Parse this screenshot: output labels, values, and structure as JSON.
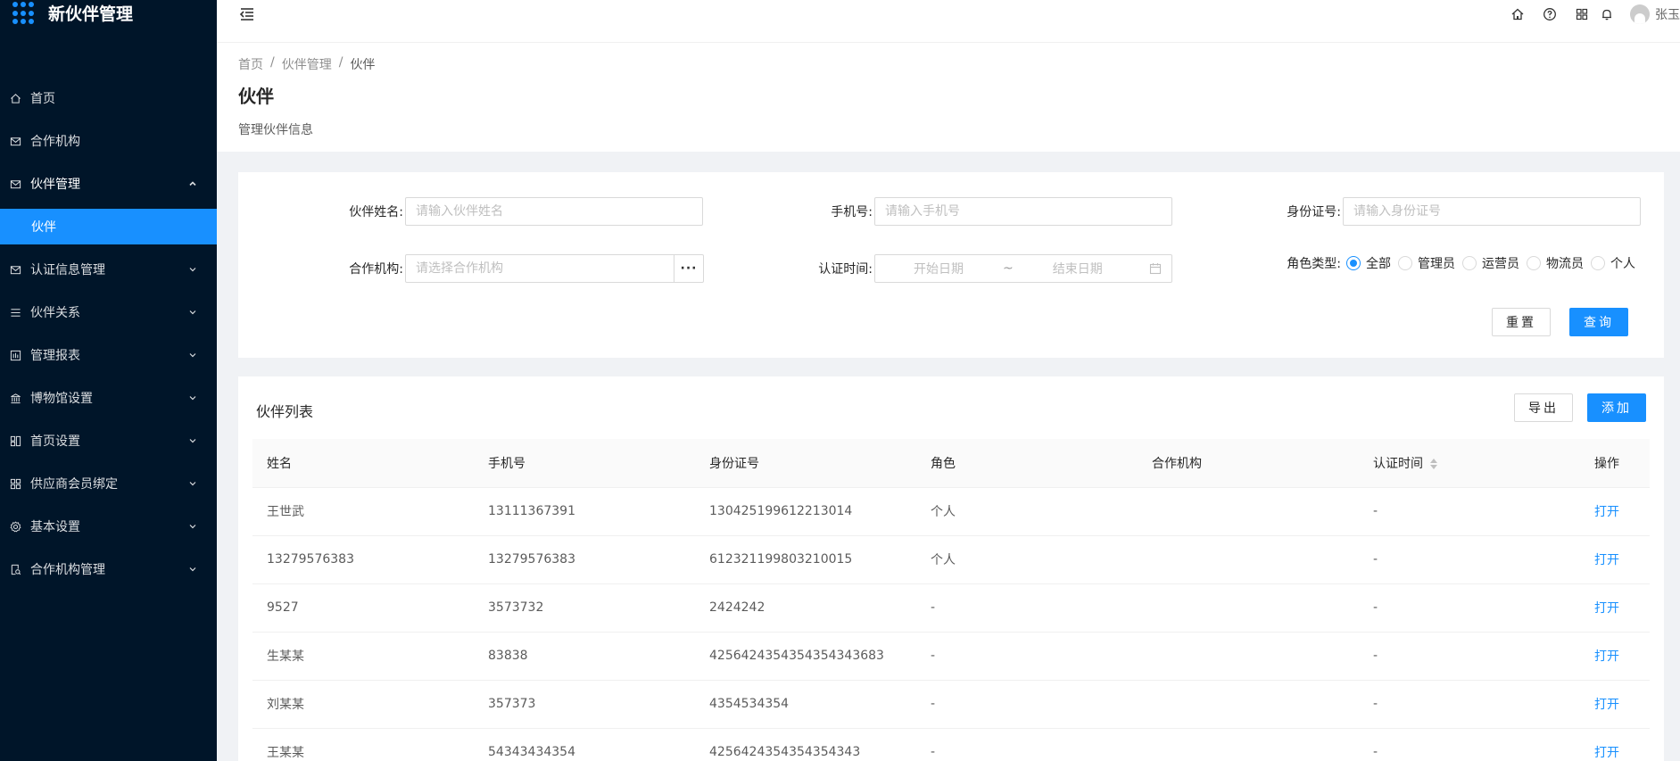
{
  "app": {
    "title": "新伙伴管理"
  },
  "sidebar": {
    "items": [
      {
        "label": "首页",
        "icon": "home-icon"
      },
      {
        "label": "合作机构",
        "icon": "mail-icon"
      },
      {
        "label": "伙伴管理",
        "icon": "mail-icon",
        "open": true
      },
      {
        "label": "伙伴",
        "sub": true,
        "active": true
      },
      {
        "label": "认证信息管理",
        "icon": "mail-icon"
      },
      {
        "label": "伙伴关系",
        "icon": "list-icon"
      },
      {
        "label": "管理报表",
        "icon": "report-icon"
      },
      {
        "label": "博物馆设置",
        "icon": "bank-icon"
      },
      {
        "label": "首页设置",
        "icon": "layout-icon"
      },
      {
        "label": "供应商会员绑定",
        "icon": "appstore-icon"
      },
      {
        "label": "基本设置",
        "icon": "setting-icon"
      },
      {
        "label": "合作机构管理",
        "icon": "audit-icon"
      }
    ]
  },
  "header": {
    "user_name": "张玉"
  },
  "breadcrumb": {
    "home": "首页",
    "section": "伙伴管理",
    "current": "伙伴",
    "separator": "/"
  },
  "page": {
    "title": "伙伴",
    "description": "管理伙伴信息"
  },
  "search": {
    "name_label": "伙伴姓名:",
    "name_placeholder": "请输入伙伴姓名",
    "phone_label": "手机号:",
    "phone_placeholder": "请输入手机号",
    "id_label": "身份证号:",
    "id_placeholder": "请输入身份证号",
    "org_label": "合作机构:",
    "org_placeholder": "请选择合作机构",
    "org_button": "···",
    "time_label": "认证时间:",
    "time_start_placeholder": "开始日期",
    "time_end_placeholder": "结束日期",
    "time_separator": "~",
    "role_label": "角色类型:",
    "role_options": [
      "全部",
      "管理员",
      "运营员",
      "物流员",
      "个人"
    ],
    "role_selected": "全部",
    "reset_label": "重置",
    "query_label": "查询"
  },
  "list": {
    "title": "伙伴列表",
    "export_label": "导出",
    "add_label": "添加",
    "columns": [
      "姓名",
      "手机号",
      "身份证号",
      "角色",
      "合作机构",
      "认证时间",
      "操作"
    ],
    "rows": [
      {
        "name": "王世武",
        "phone": "13111367391",
        "id_no": "130425199612213014",
        "role": "个人",
        "org": "",
        "time": "-",
        "action": "打开"
      },
      {
        "name": "13279576383",
        "phone": "13279576383",
        "id_no": "612321199803210015",
        "role": "个人",
        "org": "",
        "time": "-",
        "action": "打开"
      },
      {
        "name": "9527",
        "phone": "3573732",
        "id_no": "2424242",
        "role": "-",
        "org": "",
        "time": "-",
        "action": "打开"
      },
      {
        "name": "生某某",
        "phone": "83838",
        "id_no": "4256424354354354343683",
        "role": "-",
        "org": "",
        "time": "-",
        "action": "打开"
      },
      {
        "name": "刘某某",
        "phone": "357373",
        "id_no": "4354534354",
        "role": "-",
        "org": "",
        "time": "-",
        "action": "打开"
      },
      {
        "name": "王某某",
        "phone": "54343434354",
        "id_no": "4256424354354354343",
        "role": "-",
        "org": "",
        "time": "-",
        "action": "打开"
      }
    ]
  }
}
